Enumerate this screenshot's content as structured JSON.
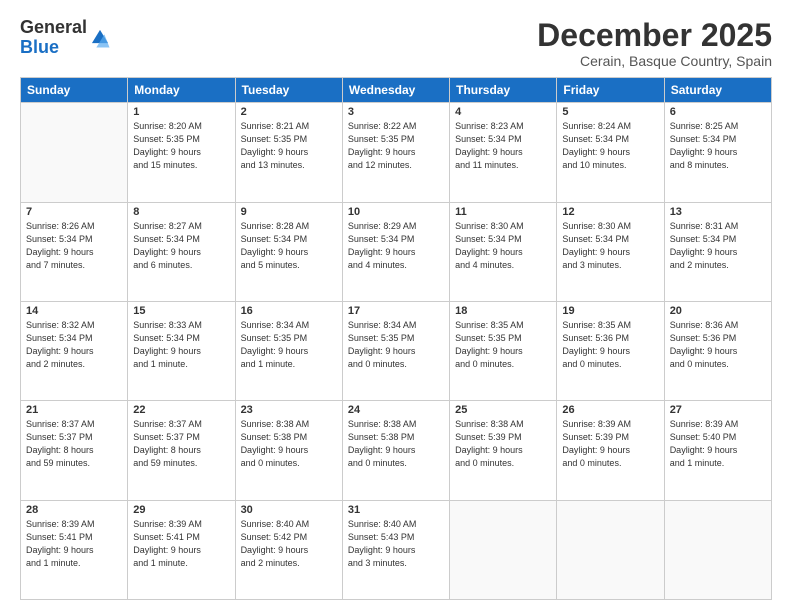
{
  "logo": {
    "general": "General",
    "blue": "Blue"
  },
  "title": "December 2025",
  "location": "Cerain, Basque Country, Spain",
  "days_header": [
    "Sunday",
    "Monday",
    "Tuesday",
    "Wednesday",
    "Thursday",
    "Friday",
    "Saturday"
  ],
  "weeks": [
    [
      {
        "num": "",
        "info": ""
      },
      {
        "num": "1",
        "info": "Sunrise: 8:20 AM\nSunset: 5:35 PM\nDaylight: 9 hours\nand 15 minutes."
      },
      {
        "num": "2",
        "info": "Sunrise: 8:21 AM\nSunset: 5:35 PM\nDaylight: 9 hours\nand 13 minutes."
      },
      {
        "num": "3",
        "info": "Sunrise: 8:22 AM\nSunset: 5:35 PM\nDaylight: 9 hours\nand 12 minutes."
      },
      {
        "num": "4",
        "info": "Sunrise: 8:23 AM\nSunset: 5:34 PM\nDaylight: 9 hours\nand 11 minutes."
      },
      {
        "num": "5",
        "info": "Sunrise: 8:24 AM\nSunset: 5:34 PM\nDaylight: 9 hours\nand 10 minutes."
      },
      {
        "num": "6",
        "info": "Sunrise: 8:25 AM\nSunset: 5:34 PM\nDaylight: 9 hours\nand 8 minutes."
      }
    ],
    [
      {
        "num": "7",
        "info": "Sunrise: 8:26 AM\nSunset: 5:34 PM\nDaylight: 9 hours\nand 7 minutes."
      },
      {
        "num": "8",
        "info": "Sunrise: 8:27 AM\nSunset: 5:34 PM\nDaylight: 9 hours\nand 6 minutes."
      },
      {
        "num": "9",
        "info": "Sunrise: 8:28 AM\nSunset: 5:34 PM\nDaylight: 9 hours\nand 5 minutes."
      },
      {
        "num": "10",
        "info": "Sunrise: 8:29 AM\nSunset: 5:34 PM\nDaylight: 9 hours\nand 4 minutes."
      },
      {
        "num": "11",
        "info": "Sunrise: 8:30 AM\nSunset: 5:34 PM\nDaylight: 9 hours\nand 4 minutes."
      },
      {
        "num": "12",
        "info": "Sunrise: 8:30 AM\nSunset: 5:34 PM\nDaylight: 9 hours\nand 3 minutes."
      },
      {
        "num": "13",
        "info": "Sunrise: 8:31 AM\nSunset: 5:34 PM\nDaylight: 9 hours\nand 2 minutes."
      }
    ],
    [
      {
        "num": "14",
        "info": "Sunrise: 8:32 AM\nSunset: 5:34 PM\nDaylight: 9 hours\nand 2 minutes."
      },
      {
        "num": "15",
        "info": "Sunrise: 8:33 AM\nSunset: 5:34 PM\nDaylight: 9 hours\nand 1 minute."
      },
      {
        "num": "16",
        "info": "Sunrise: 8:34 AM\nSunset: 5:35 PM\nDaylight: 9 hours\nand 1 minute."
      },
      {
        "num": "17",
        "info": "Sunrise: 8:34 AM\nSunset: 5:35 PM\nDaylight: 9 hours\nand 0 minutes."
      },
      {
        "num": "18",
        "info": "Sunrise: 8:35 AM\nSunset: 5:35 PM\nDaylight: 9 hours\nand 0 minutes."
      },
      {
        "num": "19",
        "info": "Sunrise: 8:35 AM\nSunset: 5:36 PM\nDaylight: 9 hours\nand 0 minutes."
      },
      {
        "num": "20",
        "info": "Sunrise: 8:36 AM\nSunset: 5:36 PM\nDaylight: 9 hours\nand 0 minutes."
      }
    ],
    [
      {
        "num": "21",
        "info": "Sunrise: 8:37 AM\nSunset: 5:37 PM\nDaylight: 8 hours\nand 59 minutes."
      },
      {
        "num": "22",
        "info": "Sunrise: 8:37 AM\nSunset: 5:37 PM\nDaylight: 8 hours\nand 59 minutes."
      },
      {
        "num": "23",
        "info": "Sunrise: 8:38 AM\nSunset: 5:38 PM\nDaylight: 9 hours\nand 0 minutes."
      },
      {
        "num": "24",
        "info": "Sunrise: 8:38 AM\nSunset: 5:38 PM\nDaylight: 9 hours\nand 0 minutes."
      },
      {
        "num": "25",
        "info": "Sunrise: 8:38 AM\nSunset: 5:39 PM\nDaylight: 9 hours\nand 0 minutes."
      },
      {
        "num": "26",
        "info": "Sunrise: 8:39 AM\nSunset: 5:39 PM\nDaylight: 9 hours\nand 0 minutes."
      },
      {
        "num": "27",
        "info": "Sunrise: 8:39 AM\nSunset: 5:40 PM\nDaylight: 9 hours\nand 1 minute."
      }
    ],
    [
      {
        "num": "28",
        "info": "Sunrise: 8:39 AM\nSunset: 5:41 PM\nDaylight: 9 hours\nand 1 minute."
      },
      {
        "num": "29",
        "info": "Sunrise: 8:39 AM\nSunset: 5:41 PM\nDaylight: 9 hours\nand 1 minute."
      },
      {
        "num": "30",
        "info": "Sunrise: 8:40 AM\nSunset: 5:42 PM\nDaylight: 9 hours\nand 2 minutes."
      },
      {
        "num": "31",
        "info": "Sunrise: 8:40 AM\nSunset: 5:43 PM\nDaylight: 9 hours\nand 3 minutes."
      },
      {
        "num": "",
        "info": ""
      },
      {
        "num": "",
        "info": ""
      },
      {
        "num": "",
        "info": ""
      }
    ]
  ]
}
